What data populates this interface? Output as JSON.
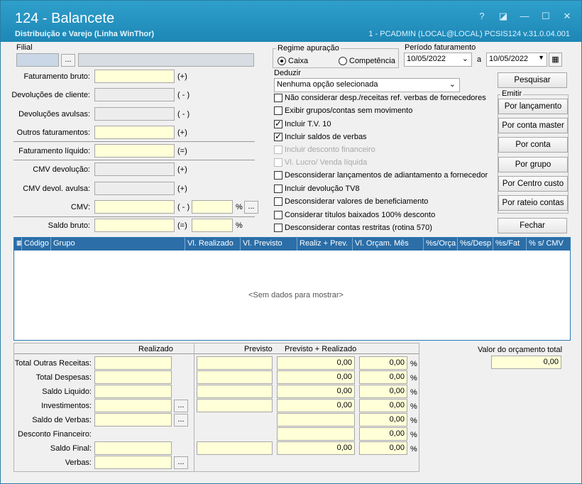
{
  "title": "124 - Balancete",
  "subtitle": "Distribuição e Varejo (Linha WinThor)",
  "user_info": "1 - PCADMIN (LOCAL@LOCAL)   PCSIS124  v.31.0.04.001",
  "window_buttons": [
    "?",
    "◪",
    "—",
    "☐",
    "✕"
  ],
  "filial": {
    "label": "Filial",
    "dots": "..."
  },
  "left_fields": [
    {
      "label": "Faturamento bruto:",
      "suffix": "(+)"
    },
    {
      "label": "Devoluções de cliente:",
      "suffix": "( - )"
    },
    {
      "label": "Devoluções avulsas:",
      "suffix": "( - )"
    },
    {
      "label": "Outros faturamentos:",
      "suffix": "(+)"
    },
    {
      "label": "Faturamento líquido:",
      "suffix": "(=)"
    },
    {
      "label": "CMV devolução:",
      "suffix": "(+)"
    },
    {
      "label": "CMV devol. avulsa:",
      "suffix": "(+)"
    },
    {
      "label": "CMV:",
      "suffix": "( - )"
    },
    {
      "label": "Saldo bruto:",
      "suffix": "(=)"
    }
  ],
  "pct": "%",
  "regime": {
    "label": "Regime apuração",
    "opt1": "Caixa",
    "opt2": "Competência"
  },
  "periodo": {
    "label": "Período faturamento",
    "from": "10/05/2022",
    "sep": "a",
    "to": "10/05/2022"
  },
  "deduzir": {
    "label": "Deduzir",
    "value": "Nenhuma opção selecionada"
  },
  "options": [
    {
      "label": "Não considerar desp./receitas ref. verbas de fornecedores",
      "checked": false,
      "disabled": false
    },
    {
      "label": "Exibir grupos/contas sem movimento",
      "checked": false,
      "disabled": false
    },
    {
      "label": "Incluir T.V. 10",
      "checked": true,
      "disabled": false
    },
    {
      "label": "Incluir saldos de verbas",
      "checked": true,
      "disabled": false
    },
    {
      "label": "Incluir desconto financeiro",
      "checked": false,
      "disabled": true
    },
    {
      "label": "Vl. Lucro/ Venda líquida",
      "checked": false,
      "disabled": true
    },
    {
      "label": "Desconsiderar lançamentos de adiantamento a fornecedor",
      "checked": false,
      "disabled": false
    },
    {
      "label": "Incluir devolução TV8",
      "checked": false,
      "disabled": false
    },
    {
      "label": "Desconsiderar valores de beneficiamento",
      "checked": false,
      "disabled": false
    },
    {
      "label": "Considerar títulos baixados 100% desconto",
      "checked": false,
      "disabled": false
    },
    {
      "label": "Desconsiderar contas restritas (rotina 570)",
      "checked": false,
      "disabled": false
    }
  ],
  "actions": {
    "pesquisar": "Pesquisar",
    "emitir": "Emitir",
    "por_lancamento": "Por lançamento",
    "por_conta_master": "Por conta master",
    "por_conta": "Por conta",
    "por_grupo": "Por grupo",
    "por_centro_custo": "Por Centro custo",
    "por_rateio": "Por rateio contas",
    "fechar": "Fechar"
  },
  "grid": {
    "columns": [
      "Código",
      "Grupo",
      "Vl. Realizado",
      "Vl. Previsto",
      "Realiz + Prev.",
      "Vl. Orçam. Mês",
      "%s/Orça",
      "%s/Desp",
      "%s/Fat",
      "% s/ CMV"
    ],
    "empty": "<Sem dados para mostrar>"
  },
  "summary": {
    "col_realizado": "Realizado",
    "col_previsto": "Previsto",
    "col_prev_real": "Previsto + Realizado",
    "rows": [
      {
        "label": "Total Outras Receitas:",
        "prev_real": "0,00",
        "pct": "0,00"
      },
      {
        "label": "Total Despesas:",
        "prev_real": "0,00",
        "pct": "0,00"
      },
      {
        "label": "Saldo Liquido:",
        "prev_real": "0,00",
        "pct": "0,00"
      },
      {
        "label": "Investimentos:",
        "prev_real": "0,00",
        "pct": "0,00"
      },
      {
        "label": "Saldo de Verbas:",
        "prev_real": "",
        "pct": "0,00"
      },
      {
        "label": "Desconto Financeiro:",
        "prev_real": "",
        "pct": "0,00"
      },
      {
        "label": "Saldo Final:",
        "prev_real": "0,00",
        "pct": "0,00"
      },
      {
        "label": "Verbas:",
        "prev_real": "",
        "pct": ""
      }
    ],
    "orcamento_label": "Valor do orçamento total",
    "orcamento_value": "0,00"
  }
}
